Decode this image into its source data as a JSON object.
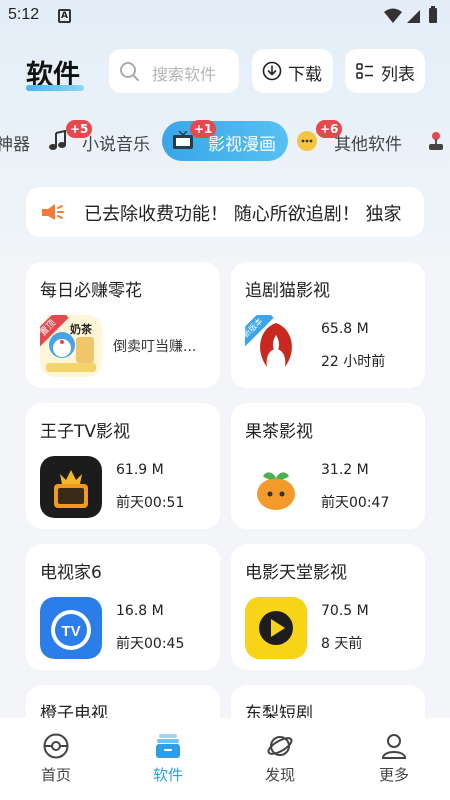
{
  "status_bar": {
    "time": "5:12",
    "notification_icon": "A"
  },
  "header": {
    "title": "软件",
    "search_placeholder": "搜索软件",
    "download_label": "下载",
    "list_label": "列表"
  },
  "tabs": [
    {
      "label": "神器",
      "badge": ""
    },
    {
      "label": "小说音乐",
      "badge": "+5"
    },
    {
      "label": "影视漫画",
      "badge": "+1",
      "active": true
    },
    {
      "label": "其他软件",
      "badge": "+6"
    }
  ],
  "notice": {
    "text": "已去除收费功能！ 随心所欲追剧！ 独家"
  },
  "cards": [
    {
      "name": "每日必赚零花",
      "desc": "倒卖叮当赚...",
      "ribbon": "置顶",
      "icon_text": "奶茶"
    },
    {
      "name": "追剧猫影视",
      "size": "65.8 M",
      "time": "22 小时前",
      "ribbon": "新版本"
    },
    {
      "name": "王子TV影视",
      "size": "61.9 M",
      "time": "前天00:51"
    },
    {
      "name": "果茶影视",
      "size": "31.2 M",
      "time": "前天00:47"
    },
    {
      "name": "电视家6",
      "size": "16.8 M",
      "time": "前天00:45"
    },
    {
      "name": "电影天堂影视",
      "size": "70.5 M",
      "time": "8 天前"
    },
    {
      "name": "橙子电视"
    },
    {
      "name": "东梨短剧"
    }
  ],
  "bottom_nav": [
    {
      "label": "首页",
      "icon": "home-icon"
    },
    {
      "label": "软件",
      "icon": "software-icon",
      "active": true
    },
    {
      "label": "发现",
      "icon": "planet-icon"
    },
    {
      "label": "更多",
      "icon": "profile-icon"
    }
  ],
  "colors": {
    "accent": "#3aa6e9",
    "badge": "#e5484d",
    "background": "#f3f5f8"
  }
}
